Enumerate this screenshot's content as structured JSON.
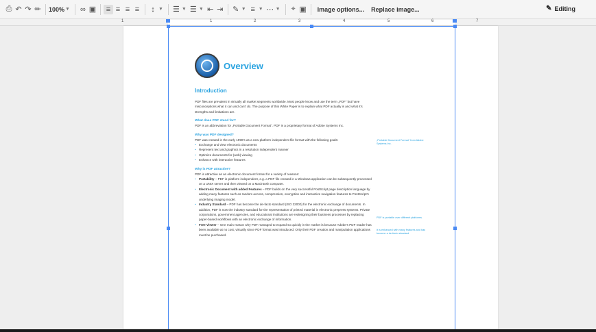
{
  "toolbar": {
    "zoom": "100%",
    "image_options": "Image options...",
    "replace_image": "Replace image...",
    "editing": "Editing"
  },
  "ruler": {
    "numbers": [
      "1",
      "1",
      "2",
      "3",
      "4",
      "5",
      "6",
      "7"
    ]
  },
  "document": {
    "title": "Overview",
    "introduction_heading": "Introduction",
    "intro_paragraph": "PDF files are prevalent in virtually all market segments worldwide. Most people know and use the term „PDF“ but have misconceptions what it can and can’t do. The purpose of this White Paper is to explain what PDF actually is and what it’s strengths and limitations are.",
    "q1_heading": "What does PDF stand for?",
    "q1_text": "PDF is an abbreviation for „Portable Document Format“. PDF is a proprietary format of Adobe Systems Inc.",
    "q2_heading": "Why was PDF designed?",
    "q2_text": "PDF was created in the early 1990’s as a new platform independent file format with the following goals:",
    "q2_bullets": [
      "Exchange and view electronic documents",
      "Represent text and graphics in a resolution independent manner",
      "Optimize documents for (web) viewing",
      "Enhance with interactive features"
    ],
    "q3_heading": "Why is PDF attractive?",
    "q3_text": "PDF is attractive as an electronic document format for a variety of reasons:",
    "q3_bullets": [
      {
        "bold": "Portability",
        "text": " – PDF is platform independent, e.g. a PDF file created in a Windows application can be subsequently processed on a UNIX server and then viewed on a Macintosh computer."
      },
      {
        "bold": "Electronic Document with added Features",
        "text": " – PDF builds on the very successful PostScript page description language by adding many features such as random access, compression, encryption and interactive navigation features to PostScript’s underlying imaging model."
      },
      {
        "bold": "Industry Standard",
        "text": " – PDF has become the de-facto standard (ISO 32000) for the electronic exchange of documents. In addition, PDF is now the industry standard for the representation of printed material in electronic prepress systems. Private corporations, government agencies, and educational institutions are redesigning their business processes by replacing paper-based workflows with an electronic exchange of information."
      },
      {
        "bold": "Free Viewer",
        "text": " – One main reason why PDF managed to expand so quickly in the market is because Adobe’s PDF reader has been available at no cost, virtually since PDF format was introduced. Only their PDF creation and manipulation applications must be purchased."
      }
    ],
    "side_note_1": "„Portable Document Format“ from Adobe Systems Inc.",
    "side_note_2": "PDF is portable over different platforms.",
    "side_note_3": "It is enhanced with many features and has become a de-facto standard."
  }
}
